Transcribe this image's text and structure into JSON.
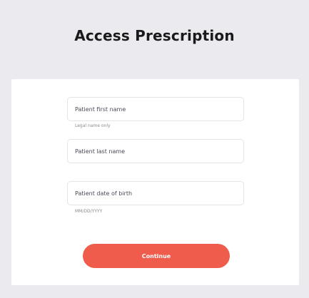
{
  "title": "Access Prescription",
  "form": {
    "first_name": {
      "placeholder": "Patient first name",
      "value": "",
      "hint": "Legal name only"
    },
    "last_name": {
      "placeholder": "Patient last name",
      "value": ""
    },
    "dob": {
      "placeholder": "Patient date of birth",
      "value": "",
      "hint": "MM/DD/YYYY"
    },
    "continue_label": "Continue"
  },
  "colors": {
    "accent": "#ef5c4b",
    "background": "#ebebef",
    "card": "#ffffff"
  }
}
